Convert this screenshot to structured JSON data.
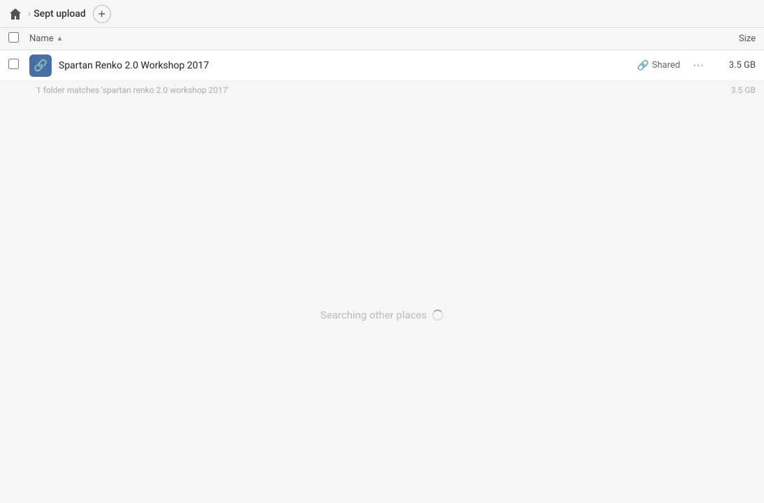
{
  "topbar": {
    "breadcrumb": {
      "home_label": "Home",
      "folder_name": "Sept upload"
    },
    "add_button_label": "+"
  },
  "table": {
    "header": {
      "name_label": "Name",
      "sort_indicator": "▲",
      "size_label": "Size"
    }
  },
  "files": [
    {
      "name": "Spartan Renko 2.0 Workshop 2017",
      "shared_label": "Shared",
      "size": "3.5 GB",
      "more_label": "···"
    }
  ],
  "summary": {
    "text": "1 folder matches 'spartan renko 2.0 workshop 2017'",
    "size": "3.5 GB"
  },
  "search": {
    "label": "Searching other places"
  }
}
